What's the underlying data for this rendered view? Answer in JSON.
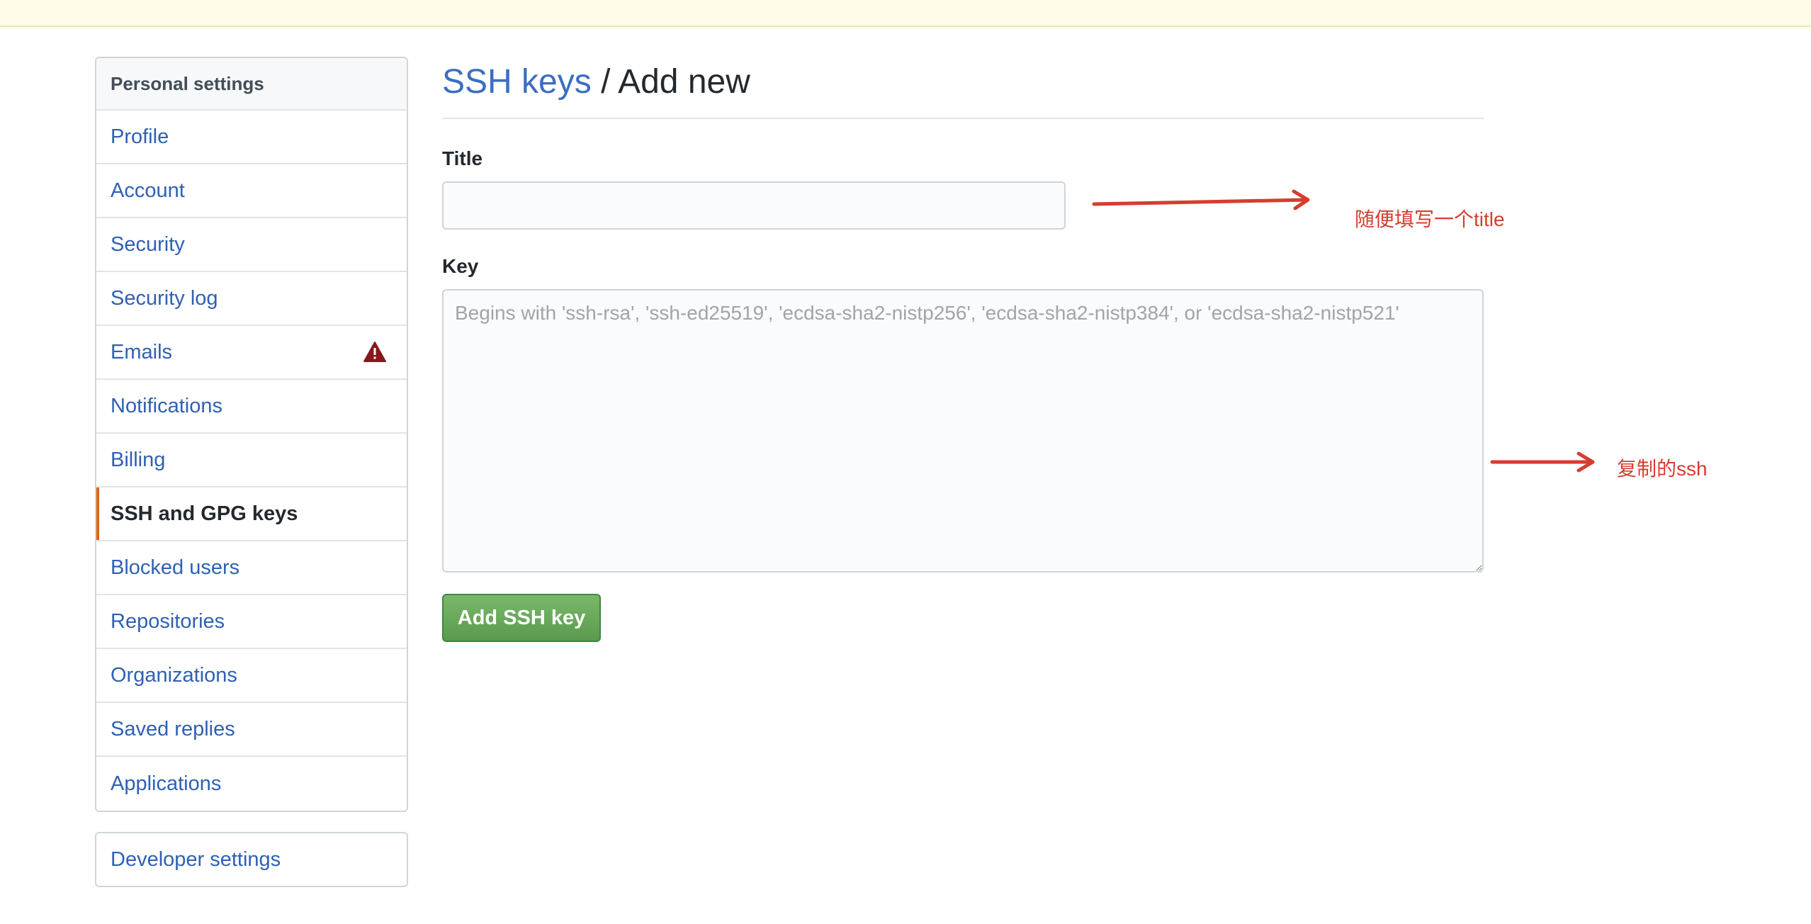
{
  "sidebar": {
    "header": "Personal settings",
    "items": [
      {
        "label": "Profile"
      },
      {
        "label": "Account"
      },
      {
        "label": "Security"
      },
      {
        "label": "Security log"
      },
      {
        "label": "Emails"
      },
      {
        "label": "Notifications"
      },
      {
        "label": "Billing"
      },
      {
        "label": "SSH and GPG keys"
      },
      {
        "label": "Blocked users"
      },
      {
        "label": "Repositories"
      },
      {
        "label": "Organizations"
      },
      {
        "label": "Saved replies"
      },
      {
        "label": "Applications"
      }
    ],
    "selected": "SSH and GPG keys",
    "emails_icon": "alert-icon",
    "developer_settings": "Developer settings"
  },
  "main": {
    "breadcrumb_link": "SSH keys",
    "breadcrumb_rest": " / Add new",
    "title_label": "Title",
    "title_value": "",
    "key_label": "Key",
    "key_placeholder": "Begins with 'ssh-rsa', 'ssh-ed25519', 'ecdsa-sha2-nistp256', 'ecdsa-sha2-nistp384', or 'ecdsa-sha2-nistp521'",
    "submit_label": "Add SSH key"
  },
  "annotations": {
    "title_note": "随便填写一个title",
    "key_note": "复制的ssh",
    "color": "#d63d2f"
  },
  "colors": {
    "link": "#2f60b4",
    "selected_accent": "#e36209",
    "button_green": "#5b9a4e",
    "notice_bar": "#fffbe6"
  }
}
